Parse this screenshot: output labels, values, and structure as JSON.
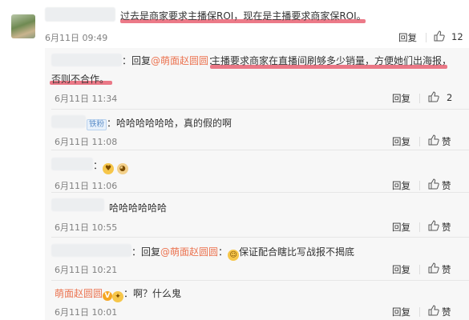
{
  "main": {
    "text": "过去是商家要求主播保ROI，现在是主播要求商家保ROI。",
    "time": "6月11日 09:49",
    "reply_label": "回复",
    "like_count": "12"
  },
  "replies": [
    {
      "prefix": "：回复",
      "mention": "@萌面赵圆圆",
      "colon": "：",
      "text_line1": "主播要求商家在直播间刷够多少销量，方便她们出海报，",
      "text_line2": "否则不合作。",
      "time": "6月11日 11:34",
      "reply_label": "回复",
      "like_count": "2"
    },
    {
      "badge": "铁粉",
      "text": "：哈哈哈哈哈哈，真的假的啊",
      "time": "6月11日 11:08",
      "reply_label": "回复",
      "like_label": "赞"
    },
    {
      "text": "：",
      "time": "6月11日 11:06",
      "reply_label": "回复",
      "like_label": "赞"
    },
    {
      "text": "哈哈哈哈哈哈",
      "time": "6月11日 10:55",
      "reply_label": "回复",
      "like_label": "赞"
    },
    {
      "prefix": "：回复",
      "mention": "@萌面赵圆圆",
      "colon": "：",
      "text": "保证配合瞎比写战报不揭底",
      "time": "6月11日 10:21",
      "reply_label": "回复",
      "like_label": "赞"
    },
    {
      "author": "萌面赵圆圆",
      "text": "：啊？什么鬼",
      "time": "6月11日 10:01",
      "reply_label": "回复",
      "like_label": "赞"
    }
  ],
  "colors": {
    "highlight": "#e4465a",
    "link": "#eb7350",
    "reply_bg": "#f7f7f7"
  },
  "icons": [
    "thumbs-up-icon",
    "vip-badge-icon",
    "emoji-icon"
  ]
}
